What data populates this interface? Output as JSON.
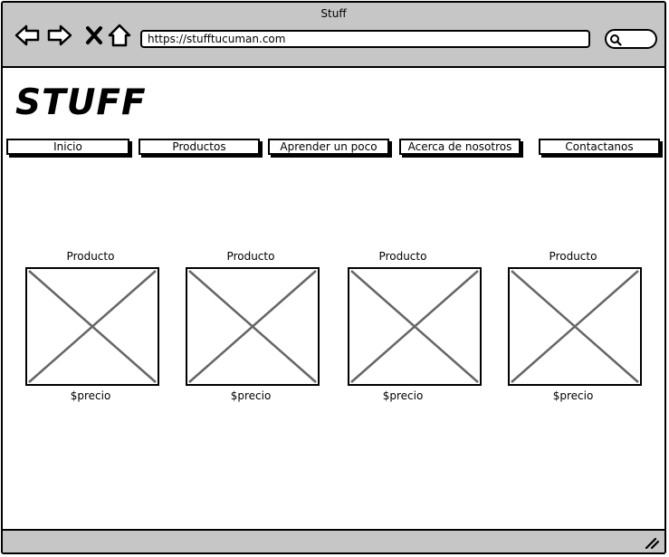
{
  "window": {
    "title": "Stuff"
  },
  "browser": {
    "url": "https://stufftucuman.com",
    "nav_icons": [
      "back-arrow-icon",
      "forward-arrow-icon",
      "close-x-icon",
      "home-icon"
    ],
    "search_icon": "search-icon"
  },
  "site": {
    "logo": "STUFF",
    "menu": [
      {
        "label": "Inicio"
      },
      {
        "label": "Productos"
      },
      {
        "label": "Aprender un poco"
      },
      {
        "label": "Acerca de nosotros"
      },
      {
        "label": "Contactanos"
      }
    ],
    "products": [
      {
        "title": "Producto",
        "price": "$precio"
      },
      {
        "title": "Producto",
        "price": "$precio"
      },
      {
        "title": "Producto",
        "price": "$precio"
      },
      {
        "title": "Producto",
        "price": "$precio"
      }
    ]
  },
  "colors": {
    "chrome": "#c6c6c6",
    "border": "#000000",
    "placeholder_lines": "#666666"
  }
}
